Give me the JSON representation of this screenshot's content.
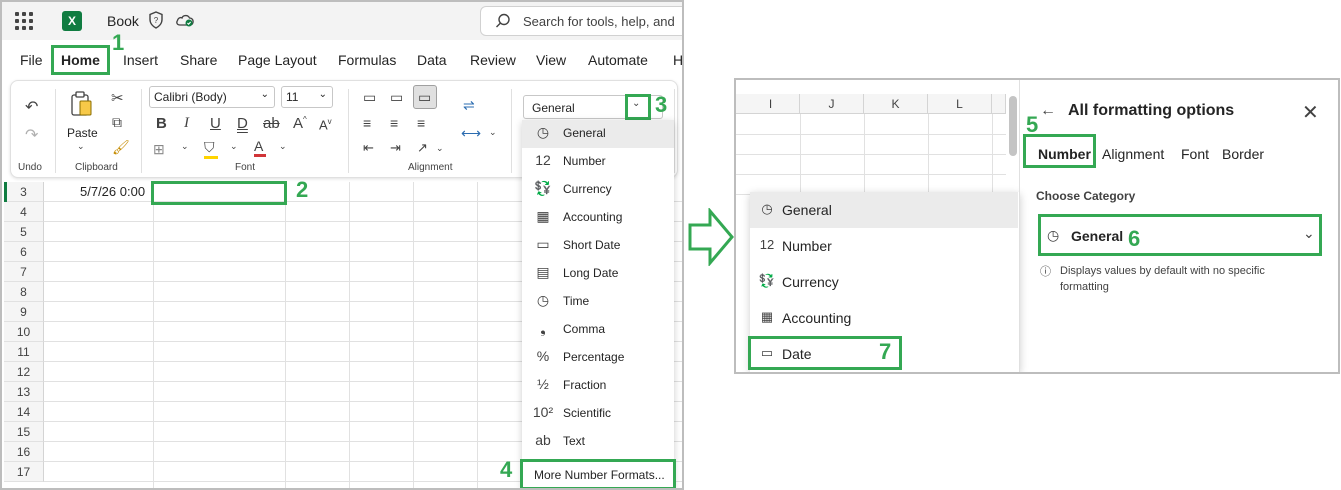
{
  "title_bar": {
    "doc_name": "Book",
    "search_placeholder": "Search for tools, help, and"
  },
  "menu_tabs": [
    "File",
    "Home",
    "Insert",
    "Share",
    "Page Layout",
    "Formulas",
    "Data",
    "Review",
    "View",
    "Automate",
    "H"
  ],
  "ribbon": {
    "undo_label": "Undo",
    "paste_label": "Paste",
    "clipboard_label": "Clipboard",
    "font_name": "Calibri (Body)",
    "font_size": "11",
    "font_label": "Font",
    "alignment_label": "Alignment",
    "number_format": "General"
  },
  "grid": {
    "rows": [
      "3",
      "4",
      "5",
      "6",
      "7",
      "8",
      "9",
      "10",
      "11",
      "12",
      "13",
      "14",
      "15",
      "16",
      "17"
    ],
    "a3_value": "5/7/26 0:00"
  },
  "number_menu": {
    "items": [
      {
        "icon": "clock-123-icon",
        "glyph": "◷",
        "label": "General"
      },
      {
        "icon": "number-12-icon",
        "glyph": "12",
        "label": "Number"
      },
      {
        "icon": "currency-icon",
        "glyph": "💱",
        "label": "Currency"
      },
      {
        "icon": "calculator-icon",
        "glyph": "▦",
        "label": "Accounting"
      },
      {
        "icon": "calendar-icon",
        "glyph": "▭",
        "label": "Short Date"
      },
      {
        "icon": "calendar-1a-icon",
        "glyph": "▤",
        "label": "Long Date"
      },
      {
        "icon": "clock-icon",
        "glyph": "◷",
        "label": "Time"
      },
      {
        "icon": "comma-icon",
        "glyph": "❟",
        "label": "Comma"
      },
      {
        "icon": "percent-icon",
        "glyph": "%",
        "label": "Percentage"
      },
      {
        "icon": "fraction-icon",
        "glyph": "½",
        "label": "Fraction"
      },
      {
        "icon": "scientific-icon",
        "glyph": "10²",
        "label": "Scientific"
      },
      {
        "icon": "text-ab-icon",
        "glyph": "ab",
        "label": "Text"
      }
    ],
    "more_label": "More Number Formats..."
  },
  "callouts": [
    "1",
    "2",
    "3",
    "4",
    "5",
    "6",
    "7"
  ],
  "right_panel": {
    "columns": [
      "I",
      "J",
      "K",
      "L"
    ],
    "category_list": [
      {
        "icon": "clock-123-icon",
        "glyph": "◷",
        "label": "General"
      },
      {
        "icon": "number-12-icon",
        "glyph": "12",
        "label": "Number"
      },
      {
        "icon": "currency-icon",
        "glyph": "💱",
        "label": "Currency"
      },
      {
        "icon": "calculator-icon",
        "glyph": "▦",
        "label": "Accounting"
      },
      {
        "icon": "calendar-icon",
        "glyph": "▭",
        "label": "Date"
      }
    ],
    "pane_title": "All formatting options",
    "pane_tabs": [
      "Number",
      "Alignment",
      "Font",
      "Border"
    ],
    "choose_category_label": "Choose Category",
    "selected_category": "General",
    "description": "Displays values by default with no specific formatting"
  },
  "colors": {
    "accent_green": "#34a853",
    "excel_green": "#107c41",
    "font_red": "#d13438",
    "fill_yellow": "#ffd400"
  }
}
